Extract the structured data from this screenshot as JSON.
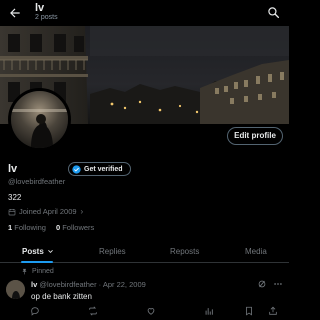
{
  "header": {
    "title": "lv",
    "subtitle": "2 posts"
  },
  "profile": {
    "edit_label": "Edit profile",
    "display_name": "lv",
    "verified_label": "Get verified",
    "handle": "@lovebirdfeather",
    "bio": "322",
    "joined": "Joined April 2009",
    "following_count": "1",
    "following_label": "Following",
    "followers_count": "0",
    "followers_label": "Followers"
  },
  "tabs": [
    {
      "label": "Posts"
    },
    {
      "label": "Replies"
    },
    {
      "label": "Reposts"
    },
    {
      "label": "Media"
    }
  ],
  "post": {
    "pinned_label": "Pinned",
    "name": "lv",
    "meta": "@lovebirdfeather · Apr 22, 2009",
    "text": "op de bank zitten"
  },
  "colors": {
    "background": "#000000",
    "accent": "#1d9bf0",
    "muted": "#71767b",
    "text": "#e7e9ea"
  },
  "icons": {
    "back": "arrow-left-icon",
    "search": "search-icon",
    "verified": "verified-badge-icon",
    "calendar": "calendar-icon",
    "pin": "pin-icon",
    "grok": "grok-icon",
    "more": "more-icon"
  }
}
